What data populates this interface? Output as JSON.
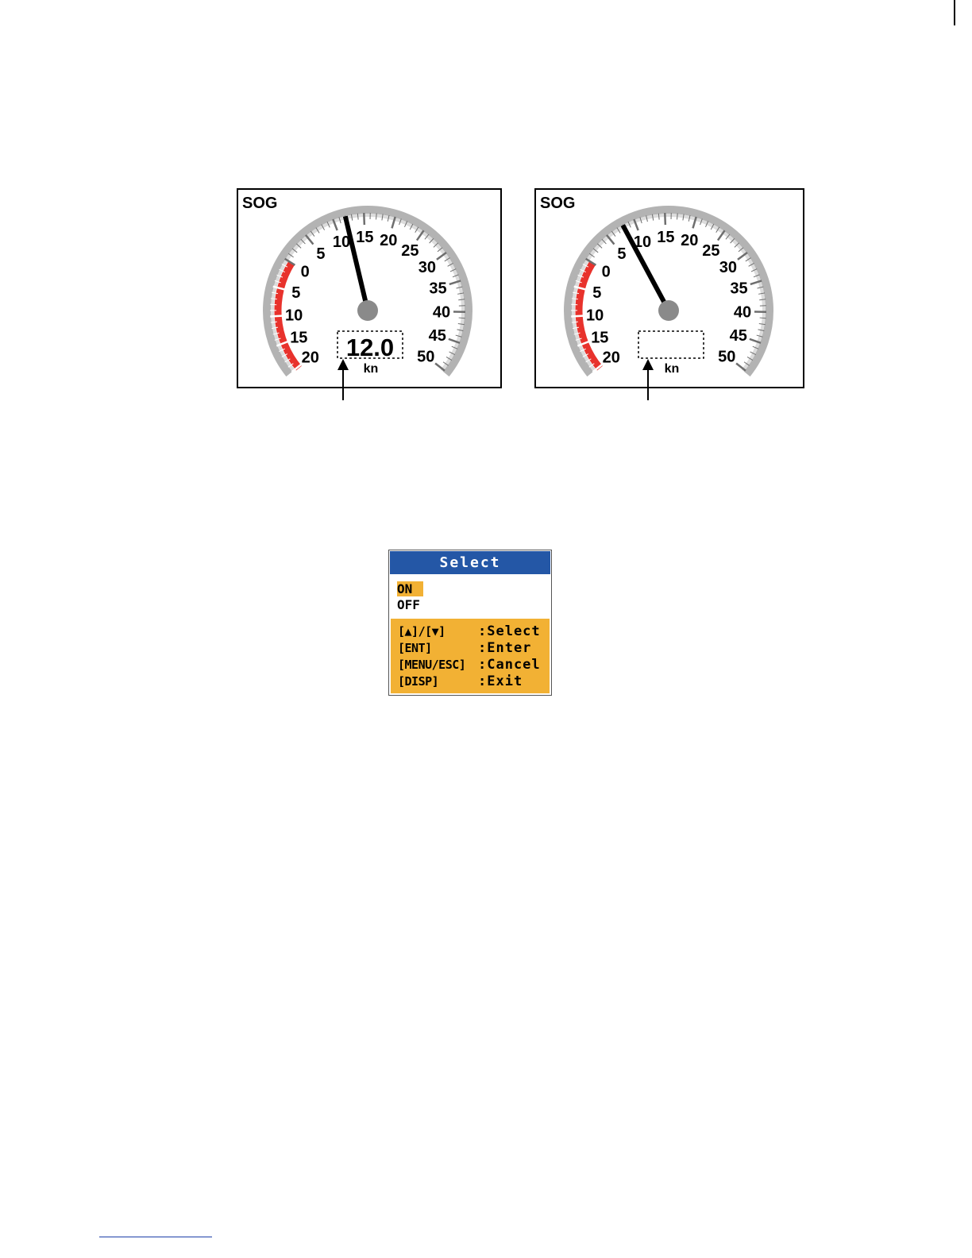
{
  "gauges": [
    {
      "id": "left",
      "title": "SOG",
      "reading": "12.0",
      "unit": "kn",
      "needle_value": 12,
      "display_box": "shown",
      "scale_left_labels": [
        "0",
        "5",
        "10",
        "15",
        "20"
      ],
      "scale_right_labels": [
        "5",
        "10",
        "15",
        "20",
        "25",
        "30",
        "35",
        "40",
        "45",
        "50"
      ]
    },
    {
      "id": "right",
      "title": "SOG",
      "reading": "",
      "unit": "kn",
      "needle_value": 8,
      "display_box": "empty",
      "scale_left_labels": [
        "0",
        "5",
        "10",
        "15",
        "20"
      ],
      "scale_right_labels": [
        "5",
        "10",
        "15",
        "20",
        "25",
        "30",
        "35",
        "40",
        "45",
        "50"
      ]
    }
  ],
  "colors": {
    "red_zone": "#e8322c",
    "bezel": "#b3b3b3",
    "dialog_title_bg": "#2457a6",
    "dialog_highlight": "#f2b134"
  },
  "select_dialog": {
    "title": "Select",
    "options": [
      {
        "label": "ON",
        "selected": true
      },
      {
        "label": "OFF",
        "selected": false
      }
    ],
    "help": [
      {
        "key": "[▲]/[▼]",
        "action": ":Select"
      },
      {
        "key": "[ENT]",
        "action": ":Enter"
      },
      {
        "key": "[MENU/ESC]",
        "action": ":Cancel"
      },
      {
        "key": "[DISP]",
        "action": ":Exit"
      }
    ]
  }
}
